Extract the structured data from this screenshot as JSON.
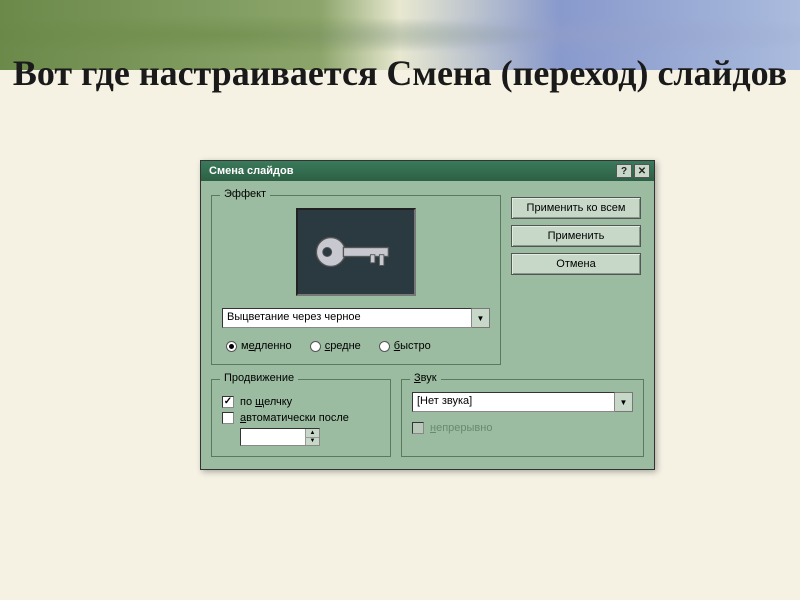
{
  "slide": {
    "title": "Вот где настраивается Смена (переход) слайдов"
  },
  "dialog": {
    "title": "Смена слайдов",
    "effect": {
      "label": "Эффект",
      "selected": "Выцветание через черное",
      "speed": {
        "slow_pre": "м",
        "slow_u": "е",
        "slow_post": "дленно",
        "med_pre": "",
        "med_u": "с",
        "med_post": "редне",
        "fast_pre": "",
        "fast_u": "б",
        "fast_post": "ыстро"
      }
    },
    "buttons": {
      "apply_all": "Применить ко всем",
      "apply": "Применить",
      "cancel": "Отмена"
    },
    "advance": {
      "label": "Продвижение",
      "click_pre": "по ",
      "click_u": "щ",
      "click_post": "елчку",
      "auto_pre": "",
      "auto_u": "а",
      "auto_post": "втоматически после"
    },
    "sound": {
      "label_pre": "",
      "label_u": "З",
      "label_post": "вук",
      "selected": "[Нет звука]",
      "loop_pre": "",
      "loop_u": "н",
      "loop_post": "епрерывно"
    }
  }
}
